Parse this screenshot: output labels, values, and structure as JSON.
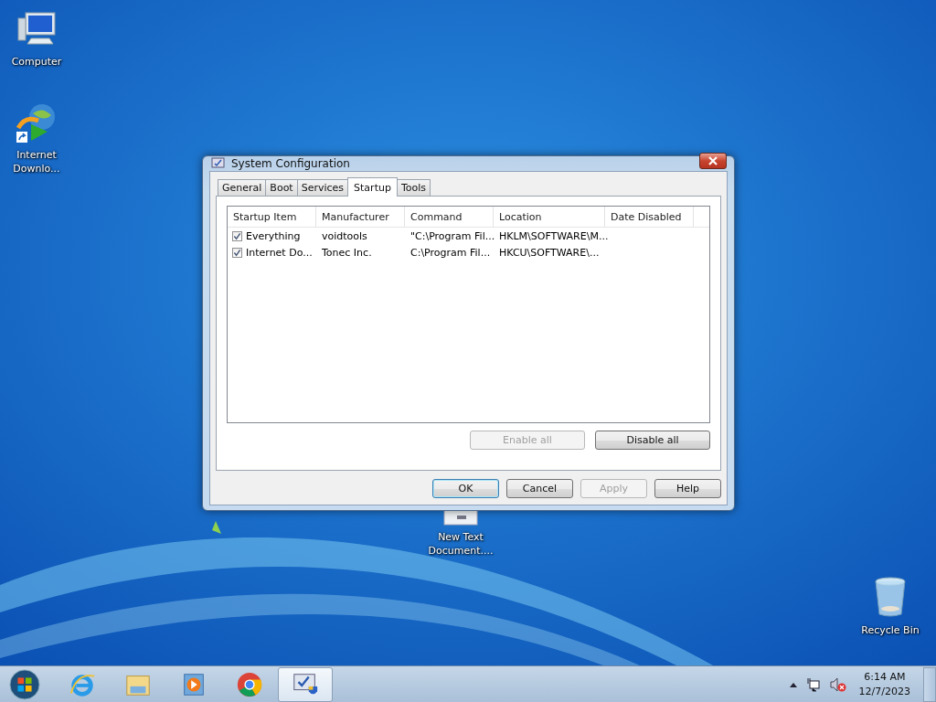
{
  "desktop_icons": [
    {
      "kind": "computer",
      "label": "Computer"
    },
    {
      "kind": "downloader",
      "label": "Internet Downlo...",
      "shortcut": true
    },
    {
      "kind": "document",
      "label": "New Text Document...."
    },
    {
      "kind": "recycle",
      "label": "Recycle Bin"
    }
  ],
  "window": {
    "title": "System Configuration",
    "tabs": [
      {
        "label": "General",
        "selected": false
      },
      {
        "label": "Boot",
        "selected": false
      },
      {
        "label": "Services",
        "selected": false
      },
      {
        "label": "Startup",
        "selected": true
      },
      {
        "label": "Tools",
        "selected": false
      }
    ],
    "table": {
      "columns": [
        "Startup Item",
        "Manufacturer",
        "Command",
        "Location",
        "Date Disabled"
      ],
      "rows": [
        {
          "checked": true,
          "cells": [
            "Everything",
            "voidtools",
            "\"C:\\Program Fil...",
            "HKLM\\SOFTWARE\\M...",
            ""
          ]
        },
        {
          "checked": true,
          "cells": [
            "Internet Do...",
            "Tonec Inc.",
            "C:\\Program Fil...",
            "HKCU\\SOFTWARE\\...",
            ""
          ]
        }
      ]
    },
    "panel_buttons": [
      {
        "label": "Enable all",
        "disabled": true
      },
      {
        "label": "Disable all",
        "disabled": false
      }
    ],
    "buttons": [
      {
        "label": "OK",
        "disabled": false,
        "default": true
      },
      {
        "label": "Cancel",
        "disabled": false,
        "default": false
      },
      {
        "label": "Apply",
        "disabled": true,
        "default": false
      },
      {
        "label": "Help",
        "disabled": false,
        "default": false
      }
    ]
  },
  "taskbar": {
    "apps": [
      {
        "kind": "ie",
        "active": false
      },
      {
        "kind": "explorer",
        "active": false
      },
      {
        "kind": "media",
        "active": false
      },
      {
        "kind": "chrome",
        "active": false
      },
      {
        "kind": "msconfig",
        "active": true
      }
    ],
    "tray": {
      "volume_muted": true,
      "time": "6:14 AM",
      "date": "12/7/2023"
    }
  }
}
